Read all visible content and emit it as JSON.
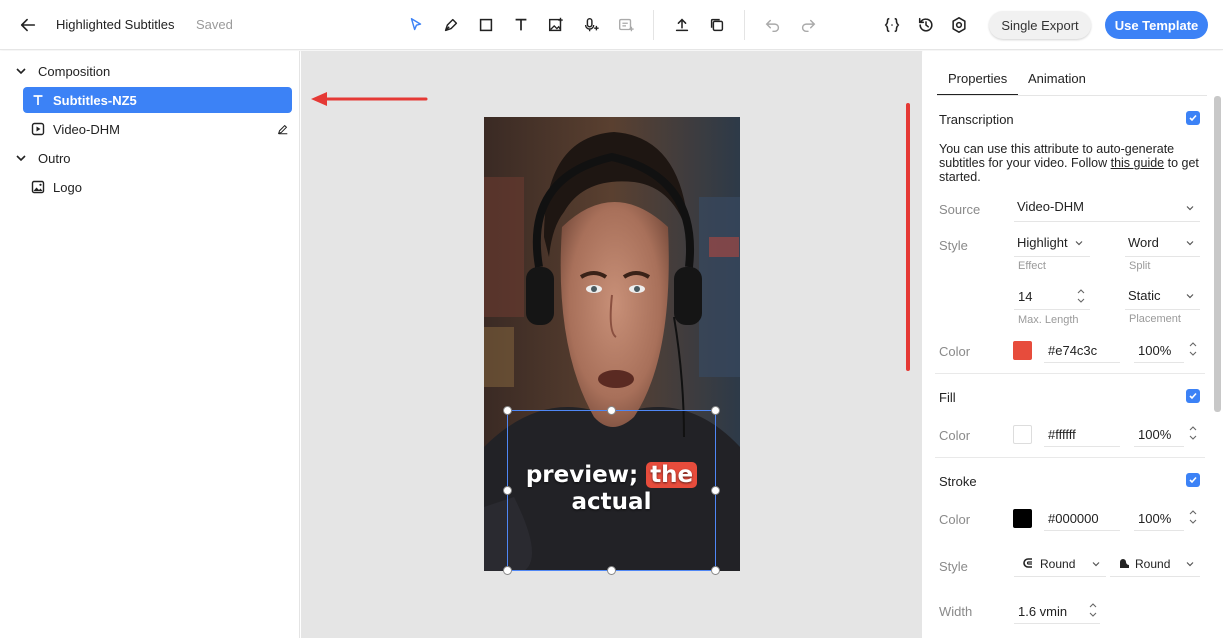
{
  "topbar": {
    "title": "Highlighted Subtitles",
    "status": "Saved",
    "single_export": "Single Export",
    "use_template": "Use Template"
  },
  "tree": {
    "items": [
      {
        "label": "Composition",
        "type": "group"
      },
      {
        "label": "Subtitles-NZ5",
        "type": "text",
        "selected": true
      },
      {
        "label": "Video-DHM",
        "type": "video"
      },
      {
        "label": "Outro",
        "type": "group"
      },
      {
        "label": "Logo",
        "type": "image"
      }
    ]
  },
  "canvas": {
    "caption_word1": "preview;",
    "caption_highlight": "the",
    "caption_line2": "actual",
    "highlight_color": "#e74c3c"
  },
  "panel": {
    "tabs": [
      "Properties",
      "Animation"
    ],
    "transcription": {
      "title": "Transcription",
      "desc_part1": "You can use this attribute to auto-generate subtitles for your video. Follow ",
      "desc_link": "this guide",
      "desc_part2": " to get started.",
      "source_label": "Source",
      "source_value": "Video-DHM",
      "style_label": "Style",
      "effect_value": "Highlight",
      "effect_label": "Effect",
      "split_value": "Word",
      "split_label": "Split",
      "maxlength_value": "14",
      "maxlength_label": "Max. Length",
      "placement_value": "Static",
      "placement_label": "Placement",
      "color_label": "Color",
      "color_hex": "#e74c3c",
      "color_opacity": "100%"
    },
    "fill": {
      "title": "Fill",
      "color_label": "Color",
      "color_hex": "#ffffff",
      "color_opacity": "100%"
    },
    "stroke": {
      "title": "Stroke",
      "color_label": "Color",
      "color_hex": "#000000",
      "color_opacity": "100%",
      "style_label": "Style",
      "cap_value": "Round",
      "join_value": "Round",
      "width_label": "Width",
      "width_value": "1.6 vmin"
    }
  }
}
